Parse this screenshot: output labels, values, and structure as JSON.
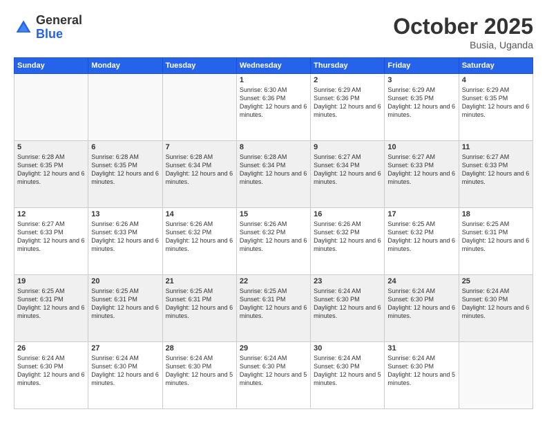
{
  "logo": {
    "general": "General",
    "blue": "Blue"
  },
  "header": {
    "month": "October 2025",
    "location": "Busia, Uganda"
  },
  "weekdays": [
    "Sunday",
    "Monday",
    "Tuesday",
    "Wednesday",
    "Thursday",
    "Friday",
    "Saturday"
  ],
  "rows": [
    [
      {
        "day": "",
        "sunrise": "",
        "sunset": "",
        "daylight": ""
      },
      {
        "day": "",
        "sunrise": "",
        "sunset": "",
        "daylight": ""
      },
      {
        "day": "",
        "sunrise": "",
        "sunset": "",
        "daylight": ""
      },
      {
        "day": "1",
        "sunrise": "Sunrise: 6:30 AM",
        "sunset": "Sunset: 6:36 PM",
        "daylight": "Daylight: 12 hours and 6 minutes."
      },
      {
        "day": "2",
        "sunrise": "Sunrise: 6:29 AM",
        "sunset": "Sunset: 6:36 PM",
        "daylight": "Daylight: 12 hours and 6 minutes."
      },
      {
        "day": "3",
        "sunrise": "Sunrise: 6:29 AM",
        "sunset": "Sunset: 6:35 PM",
        "daylight": "Daylight: 12 hours and 6 minutes."
      },
      {
        "day": "4",
        "sunrise": "Sunrise: 6:29 AM",
        "sunset": "Sunset: 6:35 PM",
        "daylight": "Daylight: 12 hours and 6 minutes."
      }
    ],
    [
      {
        "day": "5",
        "sunrise": "Sunrise: 6:28 AM",
        "sunset": "Sunset: 6:35 PM",
        "daylight": "Daylight: 12 hours and 6 minutes."
      },
      {
        "day": "6",
        "sunrise": "Sunrise: 6:28 AM",
        "sunset": "Sunset: 6:35 PM",
        "daylight": "Daylight: 12 hours and 6 minutes."
      },
      {
        "day": "7",
        "sunrise": "Sunrise: 6:28 AM",
        "sunset": "Sunset: 6:34 PM",
        "daylight": "Daylight: 12 hours and 6 minutes."
      },
      {
        "day": "8",
        "sunrise": "Sunrise: 6:28 AM",
        "sunset": "Sunset: 6:34 PM",
        "daylight": "Daylight: 12 hours and 6 minutes."
      },
      {
        "day": "9",
        "sunrise": "Sunrise: 6:27 AM",
        "sunset": "Sunset: 6:34 PM",
        "daylight": "Daylight: 12 hours and 6 minutes."
      },
      {
        "day": "10",
        "sunrise": "Sunrise: 6:27 AM",
        "sunset": "Sunset: 6:33 PM",
        "daylight": "Daylight: 12 hours and 6 minutes."
      },
      {
        "day": "11",
        "sunrise": "Sunrise: 6:27 AM",
        "sunset": "Sunset: 6:33 PM",
        "daylight": "Daylight: 12 hours and 6 minutes."
      }
    ],
    [
      {
        "day": "12",
        "sunrise": "Sunrise: 6:27 AM",
        "sunset": "Sunset: 6:33 PM",
        "daylight": "Daylight: 12 hours and 6 minutes."
      },
      {
        "day": "13",
        "sunrise": "Sunrise: 6:26 AM",
        "sunset": "Sunset: 6:33 PM",
        "daylight": "Daylight: 12 hours and 6 minutes."
      },
      {
        "day": "14",
        "sunrise": "Sunrise: 6:26 AM",
        "sunset": "Sunset: 6:32 PM",
        "daylight": "Daylight: 12 hours and 6 minutes."
      },
      {
        "day": "15",
        "sunrise": "Sunrise: 6:26 AM",
        "sunset": "Sunset: 6:32 PM",
        "daylight": "Daylight: 12 hours and 6 minutes."
      },
      {
        "day": "16",
        "sunrise": "Sunrise: 6:26 AM",
        "sunset": "Sunset: 6:32 PM",
        "daylight": "Daylight: 12 hours and 6 minutes."
      },
      {
        "day": "17",
        "sunrise": "Sunrise: 6:25 AM",
        "sunset": "Sunset: 6:32 PM",
        "daylight": "Daylight: 12 hours and 6 minutes."
      },
      {
        "day": "18",
        "sunrise": "Sunrise: 6:25 AM",
        "sunset": "Sunset: 6:31 PM",
        "daylight": "Daylight: 12 hours and 6 minutes."
      }
    ],
    [
      {
        "day": "19",
        "sunrise": "Sunrise: 6:25 AM",
        "sunset": "Sunset: 6:31 PM",
        "daylight": "Daylight: 12 hours and 6 minutes."
      },
      {
        "day": "20",
        "sunrise": "Sunrise: 6:25 AM",
        "sunset": "Sunset: 6:31 PM",
        "daylight": "Daylight: 12 hours and 6 minutes."
      },
      {
        "day": "21",
        "sunrise": "Sunrise: 6:25 AM",
        "sunset": "Sunset: 6:31 PM",
        "daylight": "Daylight: 12 hours and 6 minutes."
      },
      {
        "day": "22",
        "sunrise": "Sunrise: 6:25 AM",
        "sunset": "Sunset: 6:31 PM",
        "daylight": "Daylight: 12 hours and 6 minutes."
      },
      {
        "day": "23",
        "sunrise": "Sunrise: 6:24 AM",
        "sunset": "Sunset: 6:30 PM",
        "daylight": "Daylight: 12 hours and 6 minutes."
      },
      {
        "day": "24",
        "sunrise": "Sunrise: 6:24 AM",
        "sunset": "Sunset: 6:30 PM",
        "daylight": "Daylight: 12 hours and 6 minutes."
      },
      {
        "day": "25",
        "sunrise": "Sunrise: 6:24 AM",
        "sunset": "Sunset: 6:30 PM",
        "daylight": "Daylight: 12 hours and 6 minutes."
      }
    ],
    [
      {
        "day": "26",
        "sunrise": "Sunrise: 6:24 AM",
        "sunset": "Sunset: 6:30 PM",
        "daylight": "Daylight: 12 hours and 6 minutes."
      },
      {
        "day": "27",
        "sunrise": "Sunrise: 6:24 AM",
        "sunset": "Sunset: 6:30 PM",
        "daylight": "Daylight: 12 hours and 6 minutes."
      },
      {
        "day": "28",
        "sunrise": "Sunrise: 6:24 AM",
        "sunset": "Sunset: 6:30 PM",
        "daylight": "Daylight: 12 hours and 5 minutes."
      },
      {
        "day": "29",
        "sunrise": "Sunrise: 6:24 AM",
        "sunset": "Sunset: 6:30 PM",
        "daylight": "Daylight: 12 hours and 5 minutes."
      },
      {
        "day": "30",
        "sunrise": "Sunrise: 6:24 AM",
        "sunset": "Sunset: 6:30 PM",
        "daylight": "Daylight: 12 hours and 5 minutes."
      },
      {
        "day": "31",
        "sunrise": "Sunrise: 6:24 AM",
        "sunset": "Sunset: 6:30 PM",
        "daylight": "Daylight: 12 hours and 5 minutes."
      },
      {
        "day": "",
        "sunrise": "",
        "sunset": "",
        "daylight": ""
      }
    ]
  ]
}
